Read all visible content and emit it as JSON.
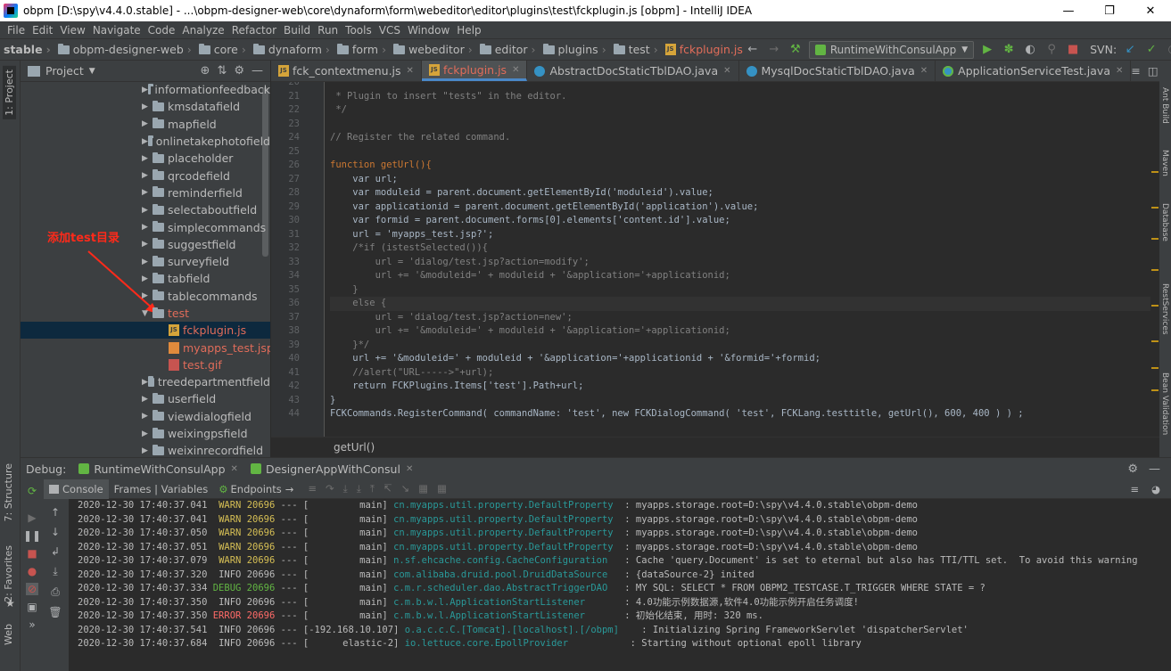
{
  "window": {
    "title": "obpm [D:\\spy\\v4.4.0.stable] - ...\\obpm-designer-web\\core\\dynaform\\form\\webeditor\\editor\\plugins\\test\\fckplugin.js [obpm] - IntelliJ IDEA"
  },
  "menu": [
    "File",
    "Edit",
    "View",
    "Navigate",
    "Code",
    "Analyze",
    "Refactor",
    "Build",
    "Run",
    "Tools",
    "VCS",
    "Window",
    "Help"
  ],
  "breadcrumbs": [
    "stable",
    "obpm-designer-web",
    "core",
    "dynaform",
    "form",
    "webeditor",
    "editor",
    "plugins",
    "test",
    "fckplugin.js"
  ],
  "toolbar": {
    "run_config": "RuntimeWithConsulApp",
    "svn_label": "SVN:"
  },
  "left_strip": {
    "project": "1: Project",
    "structure": "7: Structure",
    "favorites": "2: Favorites",
    "web": "Web"
  },
  "right_strip": [
    "Ant Build",
    "Maven",
    "Database",
    "RestServices",
    "Bean Validation"
  ],
  "project_panel": {
    "title": "Project",
    "items": [
      {
        "label": "informationfeedback",
        "kind": "folder"
      },
      {
        "label": "kmsdatafield",
        "kind": "folder"
      },
      {
        "label": "mapfield",
        "kind": "folder"
      },
      {
        "label": "onlinetakephotofield",
        "kind": "folder"
      },
      {
        "label": "placeholder",
        "kind": "folder"
      },
      {
        "label": "qrcodefield",
        "kind": "folder"
      },
      {
        "label": "reminderfield",
        "kind": "folder"
      },
      {
        "label": "selectaboutfield",
        "kind": "folder"
      },
      {
        "label": "simplecommands",
        "kind": "folder"
      },
      {
        "label": "suggestfield",
        "kind": "folder"
      },
      {
        "label": "surveyfield",
        "kind": "folder"
      },
      {
        "label": "tabfield",
        "kind": "folder"
      },
      {
        "label": "tablecommands",
        "kind": "folder"
      },
      {
        "label": "test",
        "kind": "folder-open"
      },
      {
        "label": "fckplugin.js",
        "kind": "js"
      },
      {
        "label": "myapps_test.jsp",
        "kind": "jsp"
      },
      {
        "label": "test.gif",
        "kind": "gif"
      },
      {
        "label": "treedepartmentfield",
        "kind": "folder"
      },
      {
        "label": "userfield",
        "kind": "folder"
      },
      {
        "label": "viewdialogfield",
        "kind": "folder"
      },
      {
        "label": "weixingpsfield",
        "kind": "folder"
      },
      {
        "label": "weixinrecordfield",
        "kind": "folder"
      }
    ],
    "annotation": "添加test目录"
  },
  "editor_tabs": [
    {
      "label": "fck_contextmenu.js",
      "kind": "js",
      "active": false
    },
    {
      "label": "fckplugin.js",
      "kind": "js",
      "active": true
    },
    {
      "label": "AbstractDocStaticTblDAO.java",
      "kind": "class",
      "active": false
    },
    {
      "label": "MysqlDocStaticTblDAO.java",
      "kind": "class",
      "active": false
    },
    {
      "label": "ApplicationServiceTest.java",
      "kind": "test",
      "active": false
    }
  ],
  "code_lines": [
    {
      "n": "20",
      "t": " *"
    },
    {
      "n": "21",
      "t": " * Plugin to insert \"tests\" in the editor."
    },
    {
      "n": "22",
      "t": " */"
    },
    {
      "n": "23",
      "t": ""
    },
    {
      "n": "24",
      "t": "// Register the related command."
    },
    {
      "n": "25",
      "t": ""
    },
    {
      "n": "26",
      "t": "function getUrl(){"
    },
    {
      "n": "27",
      "t": "    var url;"
    },
    {
      "n": "28",
      "t": "    var moduleid = parent.document.getElementById('moduleid').value;"
    },
    {
      "n": "29",
      "t": "    var applicationid = parent.document.getElementById('application').value;"
    },
    {
      "n": "30",
      "t": "    var formid = parent.document.forms[0].elements['content.id'].value;"
    },
    {
      "n": "31",
      "t": "    url = 'myapps_test.jsp?';"
    },
    {
      "n": "32",
      "t": "    /*if (istestSelected()){"
    },
    {
      "n": "33",
      "t": "        url = 'dialog/test.jsp?action=modify';"
    },
    {
      "n": "34",
      "t": "        url += '&moduleid=' + moduleid + '&application='+applicationid;"
    },
    {
      "n": "35",
      "t": "    }"
    },
    {
      "n": "36",
      "t": "    else {"
    },
    {
      "n": "37",
      "t": "        url = 'dialog/test.jsp?action=new';"
    },
    {
      "n": "38",
      "t": "        url += '&moduleid=' + moduleid + '&application='+applicationid;"
    },
    {
      "n": "39",
      "t": "    }*/"
    },
    {
      "n": "40",
      "t": "    url += '&moduleid=' + moduleid + '&application='+applicationid + '&formid='+formid;"
    },
    {
      "n": "41",
      "t": "    //alert(\"URL----->\"+url);"
    },
    {
      "n": "42",
      "t": "    return FCKPlugins.Items['test'].Path+url;"
    },
    {
      "n": "43",
      "t": "}"
    },
    {
      "n": "44",
      "t": "FCKCommands.RegisterCommand( commandName: 'test', new FCKDialogCommand( 'test', FCKLang.testtitle, getUrl(), 600, 400 ) ) ;"
    }
  ],
  "editor_breadcrumb": "getUrl()",
  "debug": {
    "label": "Debug:",
    "tabs": [
      "RuntimeWithConsulApp",
      "DesignerAppWithConsul"
    ],
    "sub_tabs": [
      "Console",
      "Frames | Variables",
      "Endpoints"
    ]
  },
  "log_lines": [
    {
      "ts": "2020-12-30 17:40:37.041",
      "lv": "WARN",
      "pid": "20696",
      "th": "         main]",
      "lg": "cn.myapps.util.property.DefaultProperty",
      "msg": " : myapps.storage.root=D:\\spy\\v4.4.0.stable\\obpm-demo"
    },
    {
      "ts": "2020-12-30 17:40:37.041",
      "lv": "WARN",
      "pid": "20696",
      "th": "         main]",
      "lg": "cn.myapps.util.property.DefaultProperty",
      "msg": " : myapps.storage.root=D:\\spy\\v4.4.0.stable\\obpm-demo"
    },
    {
      "ts": "2020-12-30 17:40:37.050",
      "lv": "WARN",
      "pid": "20696",
      "th": "         main]",
      "lg": "cn.myapps.util.property.DefaultProperty",
      "msg": " : myapps.storage.root=D:\\spy\\v4.4.0.stable\\obpm-demo"
    },
    {
      "ts": "2020-12-30 17:40:37.051",
      "lv": "WARN",
      "pid": "20696",
      "th": "         main]",
      "lg": "cn.myapps.util.property.DefaultProperty",
      "msg": " : myapps.storage.root=D:\\spy\\v4.4.0.stable\\obpm-demo"
    },
    {
      "ts": "2020-12-30 17:40:37.079",
      "lv": "WARN",
      "pid": "20696",
      "th": "         main]",
      "lg": "n.sf.ehcache.config.CacheConfiguration",
      "msg": "  : Cache 'query.Document' is set to eternal but also has TTI/TTL set.  To avoid this warning"
    },
    {
      "ts": "2020-12-30 17:40:37.320",
      "lv": "INFO",
      "pid": "20696",
      "th": "         main]",
      "lg": "com.alibaba.druid.pool.DruidDataSource",
      "msg": "  : {dataSource-2} inited"
    },
    {
      "ts": "2020-12-30 17:40:37.334",
      "lv": "DEBUG",
      "pid": "20696",
      "th": "         main]",
      "lg": "c.m.r.scheduler.dao.AbstractTriggerDAO",
      "msg": "  : MY SQL: SELECT * FROM OBPM2_TESTCASE.T_TRIGGER WHERE STATE = ?"
    },
    {
      "ts": "2020-12-30 17:40:37.350",
      "lv": "INFO",
      "pid": "20696",
      "th": "         main]",
      "lg": "c.m.b.w.l.ApplicationStartListener",
      "msg": "      : 4.0功能示例数据源,软件4.0功能示例开启任务调度!"
    },
    {
      "ts": "2020-12-30 17:40:37.350",
      "lv": "ERROR",
      "pid": "20696",
      "th": "         main]",
      "lg": "c.m.b.w.l.ApplicationStartListener",
      "msg": "      : 初始化结束, 用时: 320 ms."
    },
    {
      "ts": "2020-12-30 17:40:37.541",
      "lv": "INFO",
      "pid": "20696",
      "th": "-192.168.10.107]",
      "lg": "o.a.c.c.C.[Tomcat].[localhost].[/obpm]",
      "msg": "   : Initializing Spring FrameworkServlet 'dispatcherServlet'"
    },
    {
      "ts": "2020-12-30 17:40:37.684",
      "lv": "INFO",
      "pid": "20696",
      "th": "      elastic-2]",
      "lg": "io.lettuce.core.EpollProvider",
      "msg": "          : Starting without optional epoll library"
    }
  ],
  "colors": {
    "accent": "#4a88c7",
    "annotation": "#ff2a1a",
    "vcs_changed": "#e06c5a"
  }
}
